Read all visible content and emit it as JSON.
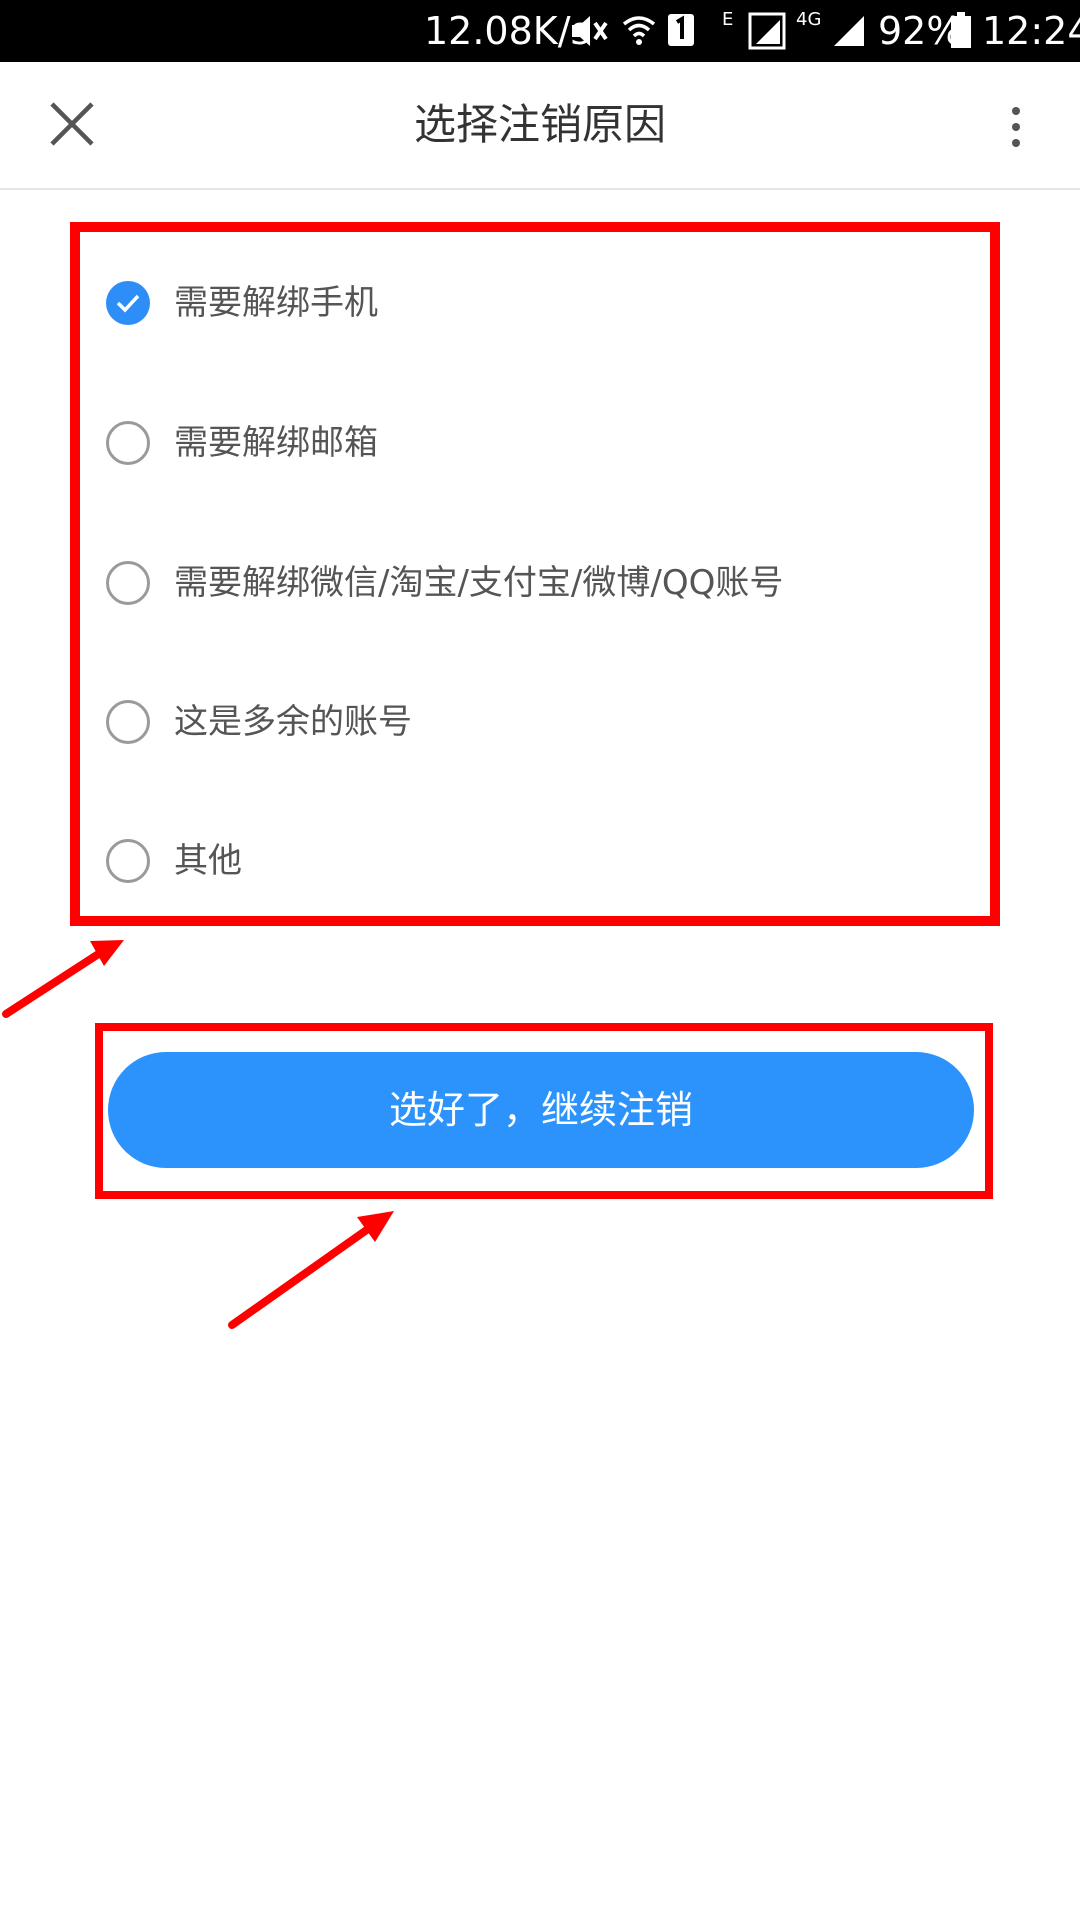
{
  "status_bar": {
    "net_speed": "12.08K/s",
    "network_e": "E",
    "network_4g": "4G",
    "battery_percent": "92%",
    "time": "12:24",
    "icons": [
      "mute-icon",
      "wifi-icon",
      "sim-icon",
      "signal-icon",
      "battery-icon"
    ]
  },
  "header": {
    "title": "选择注销原因",
    "close_icon": "close-icon",
    "more_icon": "more-vert-icon"
  },
  "options": [
    {
      "label": "需要解绑手机",
      "checked": true
    },
    {
      "label": "需要解绑邮箱",
      "checked": false
    },
    {
      "label": "需要解绑微信/淘宝/支付宝/微博/QQ账号",
      "checked": false
    },
    {
      "label": "这是多余的账号",
      "checked": false
    },
    {
      "label": "其他",
      "checked": false
    }
  ],
  "continue_button": {
    "label": "选好了，继续注销"
  },
  "colors": {
    "accent": "#2b93fb",
    "annotation": "#ff0000",
    "title_text": "#333333",
    "option_text": "#555555"
  }
}
